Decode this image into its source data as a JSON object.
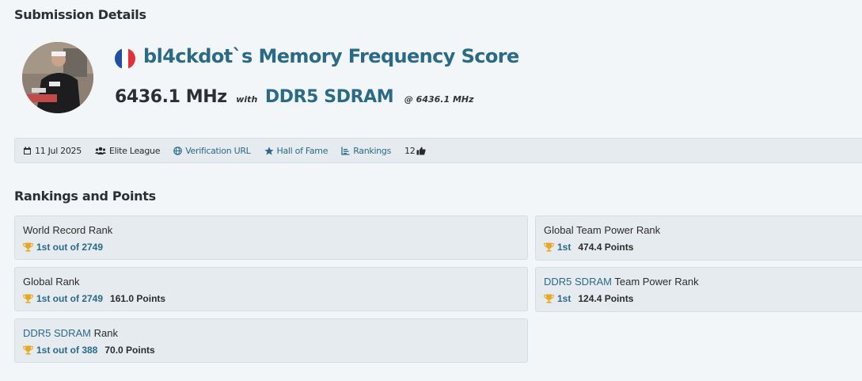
{
  "header": {
    "title": "Submission Details"
  },
  "submission": {
    "headline": "bl4ckdot`s Memory Frequency Score",
    "score": "6436.1 MHz",
    "with_label": "with",
    "hardware": "DDR5 SDRAM",
    "at_frequency": "@ 6436.1 MHz",
    "flag_country": "France"
  },
  "info_bar": {
    "date": "11 Jul 2025",
    "league": "Elite League",
    "verification": "Verification URL",
    "hall_of_fame": "Hall of Fame",
    "rankings": "Rankings",
    "likes": "12"
  },
  "rankings": {
    "title": "Rankings and Points",
    "world_record": {
      "label": "World Record Rank",
      "rank": "1st out of 2749"
    },
    "global": {
      "label": "Global Rank",
      "rank": "1st out of 2749",
      "points": "161.0 Points"
    },
    "hw_rank": {
      "label_link": "DDR5 SDRAM",
      "label_rest": "Rank",
      "rank": "1st out of 388",
      "points": "70.0 Points"
    },
    "global_team": {
      "label": "Global Team Power Rank",
      "rank": "1st",
      "points": "474.4 Points"
    },
    "hw_team": {
      "label_link": "DDR5 SDRAM",
      "label_rest": "Team Power Rank",
      "rank": "1st",
      "points": "124.4 Points"
    }
  },
  "colors": {
    "accent": "#2b6a86",
    "trophy": "#e9a823",
    "card_bg": "#e6ebef",
    "page_bg": "#f2f6f8"
  }
}
